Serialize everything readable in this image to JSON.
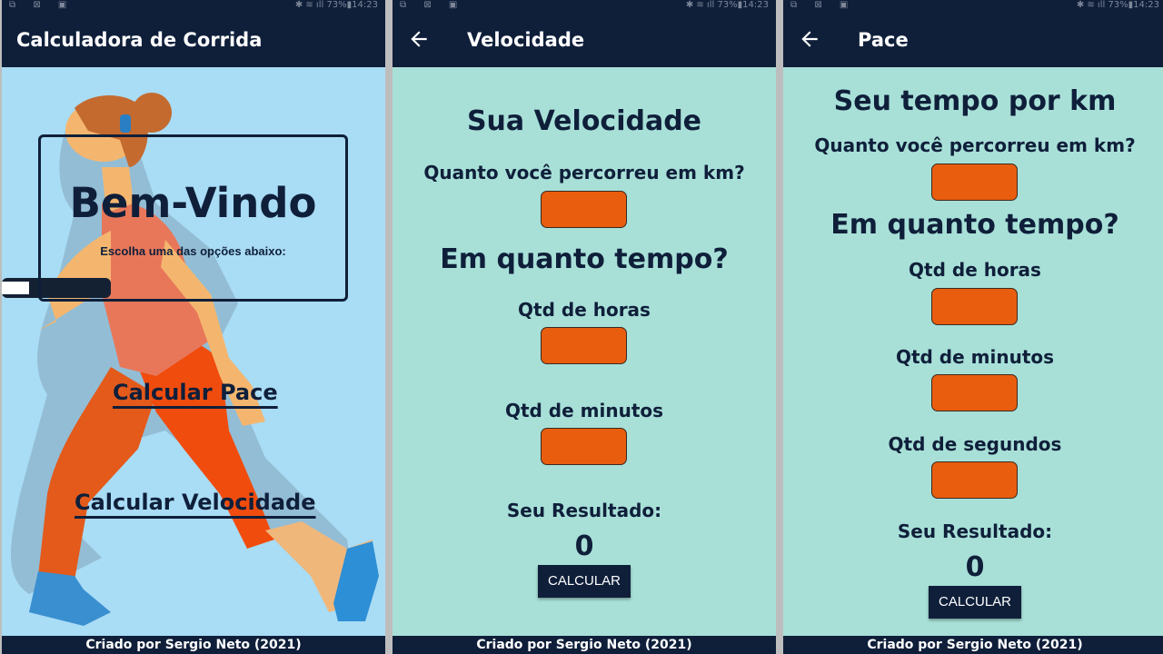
{
  "status": {
    "left_icons": "⧉ ⊠ ▣",
    "right": "✱ ≋ ıll 73%▮14:23"
  },
  "screens": {
    "home": {
      "title": "Calculadora de Corrida",
      "welcome": "Bem-Vindo",
      "subtitle": "Escolha uma das opções abaixo:",
      "link_pace": "Calcular Pace",
      "link_speed": "Calcular Velocidade",
      "footer": "Criado por Sergio Neto (2021)"
    },
    "speed": {
      "title": "Velocidade",
      "heading": "Sua Velocidade",
      "distance_label": "Quanto você percorreu em km?",
      "time_heading": "Em quanto tempo?",
      "hours_label": "Qtd de horas",
      "minutes_label": "Qtd de minutos",
      "result_label": "Seu Resultado:",
      "result_value": "0",
      "button": "CALCULAR",
      "footer": "Criado por Sergio Neto (2021)"
    },
    "pace": {
      "title": "Pace",
      "heading": "Seu tempo por km",
      "distance_label": "Quanto você percorreu em km?",
      "time_heading": "Em quanto tempo?",
      "hours_label": "Qtd de horas",
      "minutes_label": "Qtd de minutos",
      "seconds_label": "Qtd de segundos",
      "result_label": "Seu Resultado:",
      "result_value": "0",
      "button": "CALCULAR",
      "footer": "Criado por Sergio Neto (2021)"
    }
  },
  "colors": {
    "navy": "#0f1f3a",
    "sky": "#a9dcf5",
    "mint": "#a8e0d8",
    "orange_field": "#e95d0e"
  }
}
